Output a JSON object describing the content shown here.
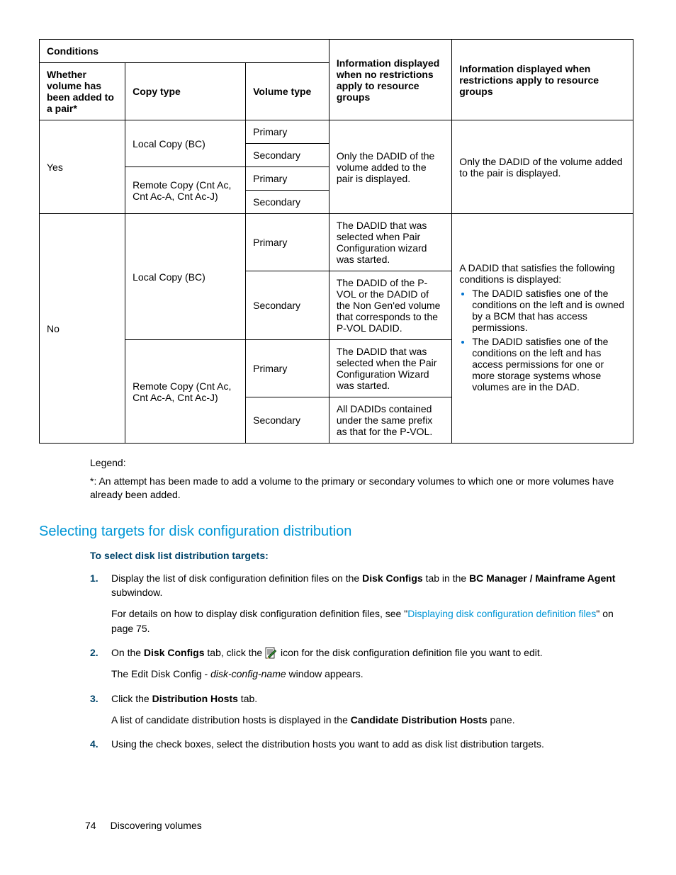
{
  "table": {
    "headers": {
      "conditions": "Conditions",
      "whether": "Whether volume has been added to a pair*",
      "copy_type": "Copy type",
      "volume_type": "Volume type",
      "no_restrict": "Information displayed when no restrictions apply to resource groups",
      "restrict": "Information displayed when restrictions apply to resource groups"
    },
    "group_yes": {
      "whether": "Yes",
      "copy_local": "Local Copy (BC)",
      "copy_remote": "Remote Copy (Cnt Ac, Cnt Ac-A, Cnt Ac-J)",
      "vt_primary": "Primary",
      "vt_secondary": "Secondary",
      "info_no_restrict": "Only the DADID of the volume added to the pair is displayed.",
      "info_restrict": "Only the DADID of the volume added to the pair is displayed."
    },
    "group_no": {
      "whether": "No",
      "copy_local": "Local Copy (BC)",
      "copy_remote": "Remote Copy (Cnt Ac, Cnt Ac-A, Cnt Ac-J)",
      "vt_primary": "Primary",
      "vt_secondary": "Secondary",
      "local_primary_info": "The DADID that was selected when Pair Configuration wizard was started.",
      "local_secondary_info": "The DADID of the P-VOL or the DADID of the Non Gen'ed volume that corresponds to the P-VOL DADID.",
      "remote_primary_info": "The DADID that was selected when the Pair Configuration Wizard was started.",
      "remote_secondary_info": "All DADIDs contained under the same prefix as that for the P-VOL.",
      "restrict_intro": "A DADID that satisfies the following conditions is displayed:",
      "restrict_b1": "The DADID satisfies one of the conditions on the left and  is owned by a BCM that has access permissions.",
      "restrict_b2": "The DADID satisfies one of the conditions on the left and has access permissions for one or more storage systems whose volumes are in the DAD."
    }
  },
  "legend": {
    "label": "Legend:",
    "note": "*: An attempt has been made to add a volume to the primary or secondary volumes to which one or more volumes have already been added."
  },
  "section": {
    "heading": "Selecting targets for disk configuration distribution",
    "sub": "To select disk list distribution targets:"
  },
  "steps": {
    "s1": {
      "num": "1.",
      "t1": "Display the list of disk configuration definition files on the ",
      "b1": "Disk Configs",
      "t2": " tab in the ",
      "b2": "BC Manager / Mainframe Agent",
      "t3": " subwindow.",
      "p2a": "For details on how to display disk configuration definition files, see \"",
      "p2link": "Displaying disk configuration definition files",
      "p2b": "\" on page 75."
    },
    "s2": {
      "num": "2.",
      "t1": "On the ",
      "b1": "Disk Configs",
      "t2": " tab, click the ",
      "t3": " icon for the disk configuration definition file you want to edit.",
      "p2a": "The Edit Disk Config - ",
      "p2i": "disk-config-name",
      "p2b": " window appears."
    },
    "s3": {
      "num": "3.",
      "t1": "Click the ",
      "b1": "Distribution Hosts",
      "t2": " tab.",
      "p2a": "A list of candidate distribution hosts is displayed in the ",
      "p2b1": "Candidate Distribution Hosts",
      "p2b": " pane."
    },
    "s4": {
      "num": "4.",
      "t1": "Using the check boxes, select the distribution hosts you want to add as disk list distribution targets."
    }
  },
  "footer": {
    "page": "74",
    "title": "Discovering volumes"
  }
}
